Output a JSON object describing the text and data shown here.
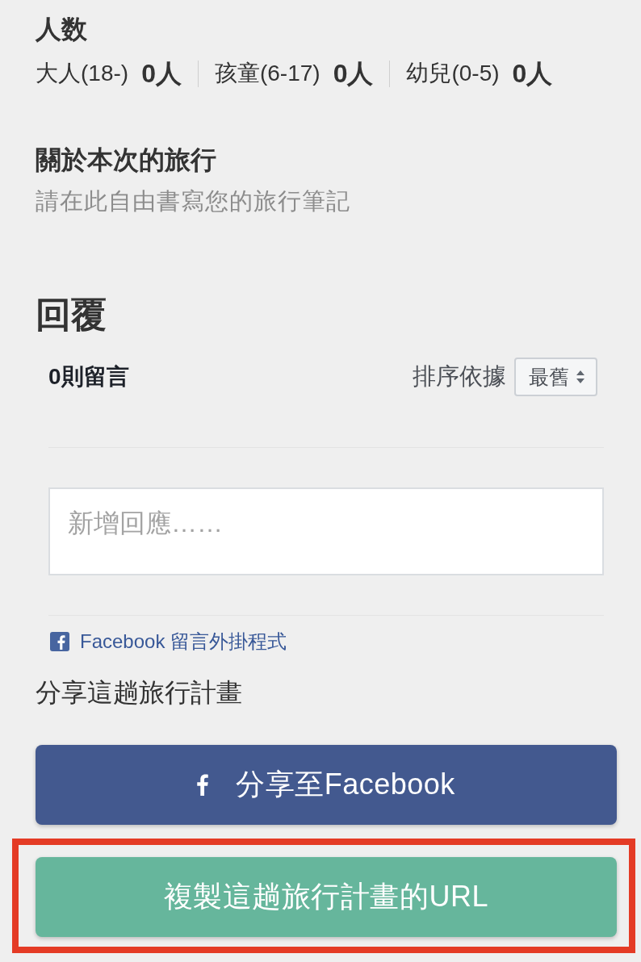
{
  "party_size": {
    "title": "人数",
    "groups": [
      {
        "label": "大人(18-)",
        "count": "0人"
      },
      {
        "label": "孩童(6-17)",
        "count": "0人"
      },
      {
        "label": "幼兒(0-5)",
        "count": "0人"
      }
    ]
  },
  "about_trip": {
    "title": "關於本次的旅行",
    "note": "請在此自由書寫您的旅行筆記"
  },
  "replies": {
    "title": "回覆",
    "comment_count": "0則留言",
    "sort_label": "排序依據",
    "sort_value": "最舊",
    "comment_box": {
      "placeholder": "新增回應……"
    },
    "plugin_link": "Facebook 留言外掛程式"
  },
  "share": {
    "title": "分享這趟旅行計畫",
    "buttons": [
      {
        "kind": "facebook",
        "label": "分享至Facebook",
        "highlighted": false
      },
      {
        "kind": "copy_url",
        "label": "複製這趟旅行計畫的URL",
        "highlighted": true
      }
    ]
  }
}
